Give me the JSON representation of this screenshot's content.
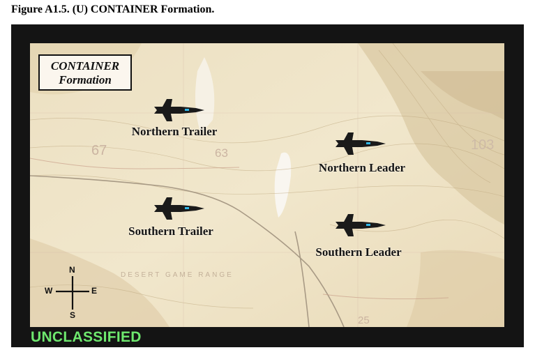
{
  "figure_caption": "Figure A1.5.  (U)   CONTAINER Formation.",
  "diagram_title": {
    "line1": "CONTAINER",
    "line2": "Formation"
  },
  "aircraft": [
    {
      "label": "Northern Trailer"
    },
    {
      "label": "Northern Leader"
    },
    {
      "label": "Southern Trailer"
    },
    {
      "label": "Southern Leader"
    }
  ],
  "map_labels": [
    "67",
    "63",
    "103",
    "DESERT GAME RANGE",
    "25"
  ],
  "compass": {
    "north": "N",
    "south": "S",
    "east": "E",
    "west": "W"
  },
  "classification": "UNCLASSIFIED",
  "colors": {
    "frame": "#141414",
    "map_base": "#efe3c4",
    "classification_text": "#6ee86e",
    "jet": "#1a1a1a",
    "jet_accent": "#2fb7e8"
  }
}
